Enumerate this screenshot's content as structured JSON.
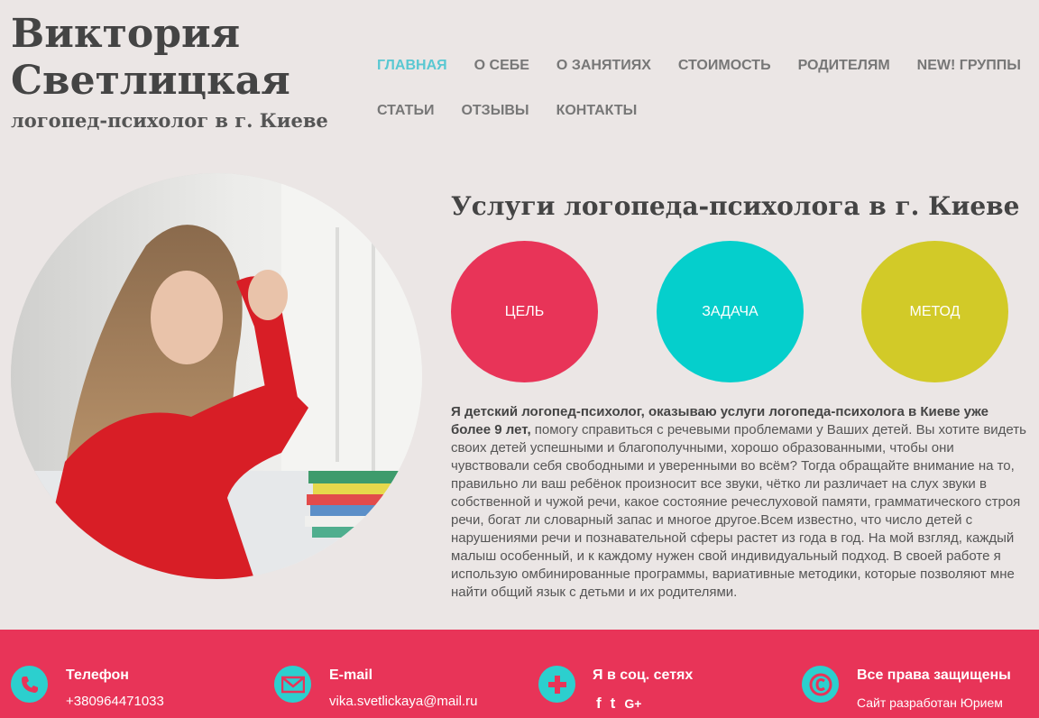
{
  "header": {
    "name_line1": "Виктория",
    "name_line2": "Светлицкая",
    "subtitle": "логопед-психолог в г. Киеве"
  },
  "nav": {
    "row1": [
      "ГЛАВНАЯ",
      "О СЕБЕ",
      "О ЗАНЯТИЯХ",
      "СТОИМОСТЬ",
      "РОДИТЕЛЯМ",
      "NEW! ГРУППЫ"
    ],
    "row2": [
      "СТАТЬИ",
      "ОТЗЫВЫ",
      "КОНТАКТЫ"
    ],
    "active": "ГЛАВНАЯ",
    "active_color": "#5ac8d2"
  },
  "main": {
    "title": "Услуги логопеда-психолога в г. Киеве",
    "circles": [
      {
        "label": "ЦЕЛЬ",
        "color": "#e83458"
      },
      {
        "label": "ЗАДАЧА",
        "color": "#05cfcc"
      },
      {
        "label": "МЕТОД",
        "color": "#d2ca28"
      }
    ],
    "intro_bold": "Я детский логопед-психолог, оказываю услуги логопеда-психолога в Киеве уже более 9 лет,",
    "intro_text": " помогу справиться с речевыми проблемами у Ваших детей. Вы хотите видеть своих детей успешными и благополучными, хорошо образованными, чтобы они чувствовали себя свободными и уверенными во всём? Тогда обращайте внимание на то, правильно ли ваш ребёнок произносит все звуки, чётко ли различает на слух звуки в собственной и чужой речи, какое состояние речеслуховой памяти, грамматического строя речи, богат ли словарный запас и многое другое.Всем известно, что число детей с нарушениями речи и познавательной сферы растет из года в год. На мой взгляд, каждый малыш особенный, и к каждому нужен свой индивидуальный подход. В своей работе я использую омбинированные программы, вариативные методики, которые позволяют мне найти общий язык с детьми и их родителями."
  },
  "footer": {
    "bg_color": "#e83458",
    "icon_color": "#2ccfce",
    "phone_title": "Телефон",
    "phone": "+380964471033",
    "email_title": "E-mail",
    "email": "vika.svetlickaya@mail.ru",
    "social_title": "Я в соц. сетях",
    "social_icons": [
      "facebook-icon",
      "twitter-icon",
      "google-plus-icon"
    ],
    "social_glyphs": [
      "f",
      "t",
      "G+"
    ],
    "rights_title": "Все права защищены",
    "rights_text": "Сайт разработан Юрием"
  }
}
